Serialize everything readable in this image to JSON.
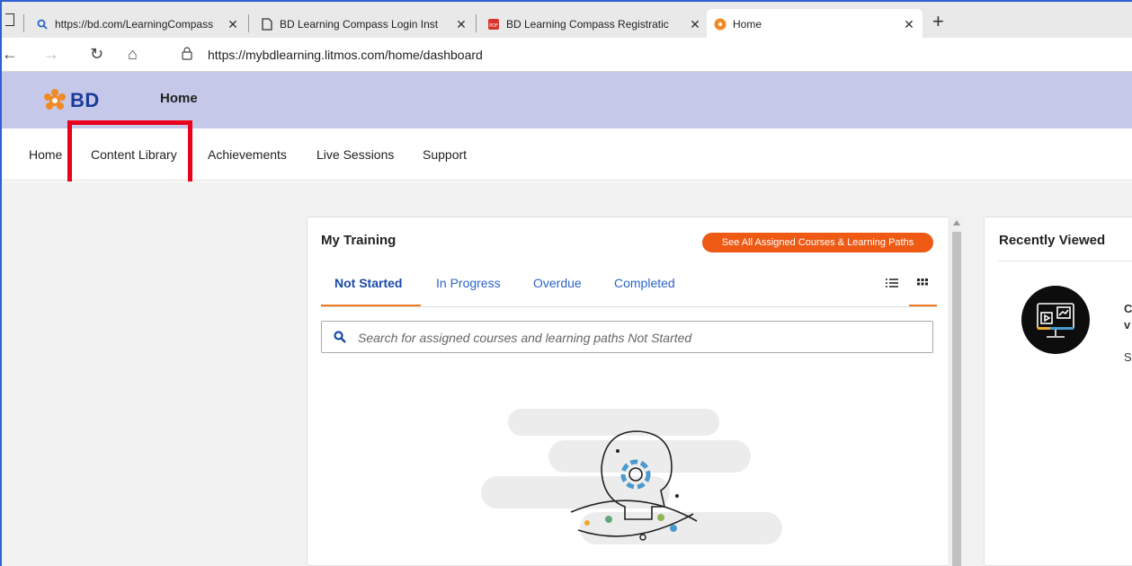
{
  "browser": {
    "tabs": [
      {
        "title": "https://bd.com/LearningCompass",
        "icon": "search-icon"
      },
      {
        "title": "BD Learning Compass Login Inst",
        "icon": "page-icon"
      },
      {
        "title": "BD Learning Compass Registratic",
        "icon": "pdf-icon"
      },
      {
        "title": "Home",
        "icon": "bd-logo-icon",
        "active": true
      }
    ],
    "url": "https://mybdlearning.litmos.com/home/dashboard"
  },
  "header": {
    "logo_text": "BD",
    "title": "Home"
  },
  "nav": {
    "items": [
      "Home",
      "Content Library",
      "Achievements",
      "Live Sessions",
      "Support"
    ]
  },
  "training": {
    "title": "My Training",
    "cta_label": "See All Assigned Courses & Learning Paths",
    "tabs": [
      "Not Started",
      "In Progress",
      "Overdue",
      "Completed"
    ],
    "search_placeholder": "Search for assigned courses and learning paths Not Started"
  },
  "recent": {
    "title": "Recently Viewed",
    "fragments": [
      "C",
      "v",
      "S"
    ]
  },
  "colors": {
    "accent_orange": "#ee5a14",
    "header_bg": "#c5c8e8",
    "link_blue": "#2a64c8",
    "highlight_red": "#e8001c"
  }
}
